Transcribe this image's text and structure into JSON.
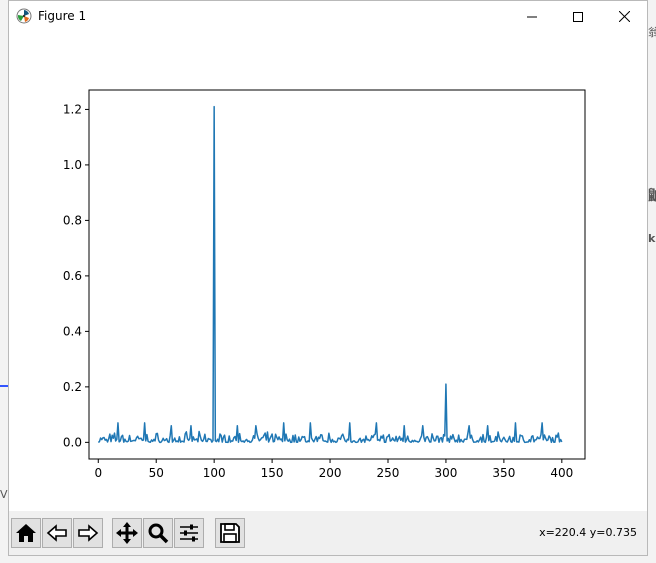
{
  "window": {
    "title": "Figure 1"
  },
  "toolbar": {
    "coords_text": "x=220.4 y=0.735",
    "buttons": [
      "home-icon",
      "back-arrow-icon",
      "forward-arrow-icon",
      "pan-icon",
      "zoom-icon",
      "subplots-icon",
      "save-icon"
    ]
  },
  "colors": {
    "line": "#1f77b4",
    "background": "#ffffff",
    "toolbar": "#f0f0f0"
  },
  "chart_data": {
    "type": "line",
    "title": "",
    "xlabel": "",
    "ylabel": "",
    "xlim": [
      -8,
      420
    ],
    "ylim": [
      -0.06,
      1.27
    ],
    "xticks": [
      0,
      50,
      100,
      150,
      200,
      250,
      300,
      350,
      400
    ],
    "yticks": [
      0.0,
      0.2,
      0.4,
      0.6,
      0.8,
      1.0,
      1.2
    ],
    "ytick_labels": [
      "0.0",
      "0.2",
      "0.4",
      "0.6",
      "0.8",
      "1.0",
      "1.2"
    ],
    "grid": false,
    "series": [
      {
        "name": "",
        "spikes": [
          {
            "x": 100,
            "y": 1.21
          },
          {
            "x": 300,
            "y": 0.21
          },
          {
            "x": 17,
            "y": 0.07
          },
          {
            "x": 40,
            "y": 0.07
          },
          {
            "x": 63,
            "y": 0.06
          },
          {
            "x": 80,
            "y": 0.06
          },
          {
            "x": 120,
            "y": 0.06
          },
          {
            "x": 136,
            "y": 0.06
          },
          {
            "x": 160,
            "y": 0.07
          },
          {
            "x": 183,
            "y": 0.07
          },
          {
            "x": 217,
            "y": 0.07
          },
          {
            "x": 240,
            "y": 0.07
          },
          {
            "x": 264,
            "y": 0.06
          },
          {
            "x": 280,
            "y": 0.06
          },
          {
            "x": 320,
            "y": 0.06
          },
          {
            "x": 336,
            "y": 0.06
          },
          {
            "x": 360,
            "y": 0.07
          },
          {
            "x": 383,
            "y": 0.07
          }
        ],
        "baseline_noise_max": 0.04,
        "x_range": [
          0,
          400
        ]
      }
    ]
  }
}
